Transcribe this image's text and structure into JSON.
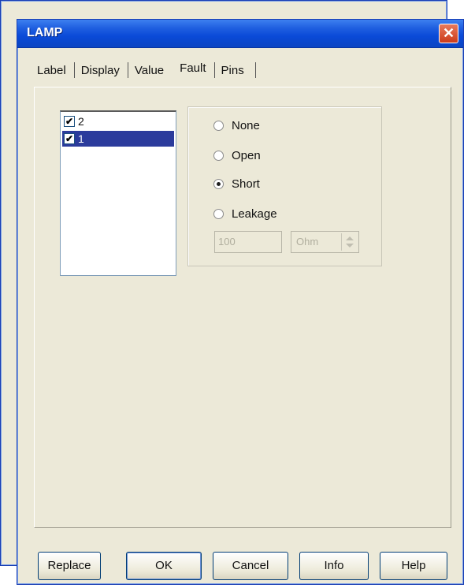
{
  "window": {
    "title": "LAMP",
    "close_label": "✕"
  },
  "tabs": [
    {
      "label": "Label",
      "active": false
    },
    {
      "label": "Display",
      "active": false
    },
    {
      "label": "Value",
      "active": false
    },
    {
      "label": "Fault",
      "active": true
    },
    {
      "label": "Pins",
      "active": false
    }
  ],
  "pins": [
    {
      "label": "2",
      "checked": true,
      "selected": false
    },
    {
      "label": "1",
      "checked": true,
      "selected": true
    }
  ],
  "fault": {
    "options": [
      {
        "label": "None",
        "selected": false
      },
      {
        "label": "Open",
        "selected": false
      },
      {
        "label": "Short",
        "selected": true
      },
      {
        "label": "Leakage",
        "selected": false
      }
    ],
    "leakage_value": "100",
    "leakage_unit": "Ohm"
  },
  "buttons": {
    "replace": "Replace",
    "ok": "OK",
    "cancel": "Cancel",
    "info": "Info",
    "help": "Help"
  },
  "colors": {
    "titlebar": "#0a4ad8",
    "dialog_bg": "#ece9d8",
    "selection": "#2b3b9c",
    "close_button": "#cc3b1a"
  }
}
